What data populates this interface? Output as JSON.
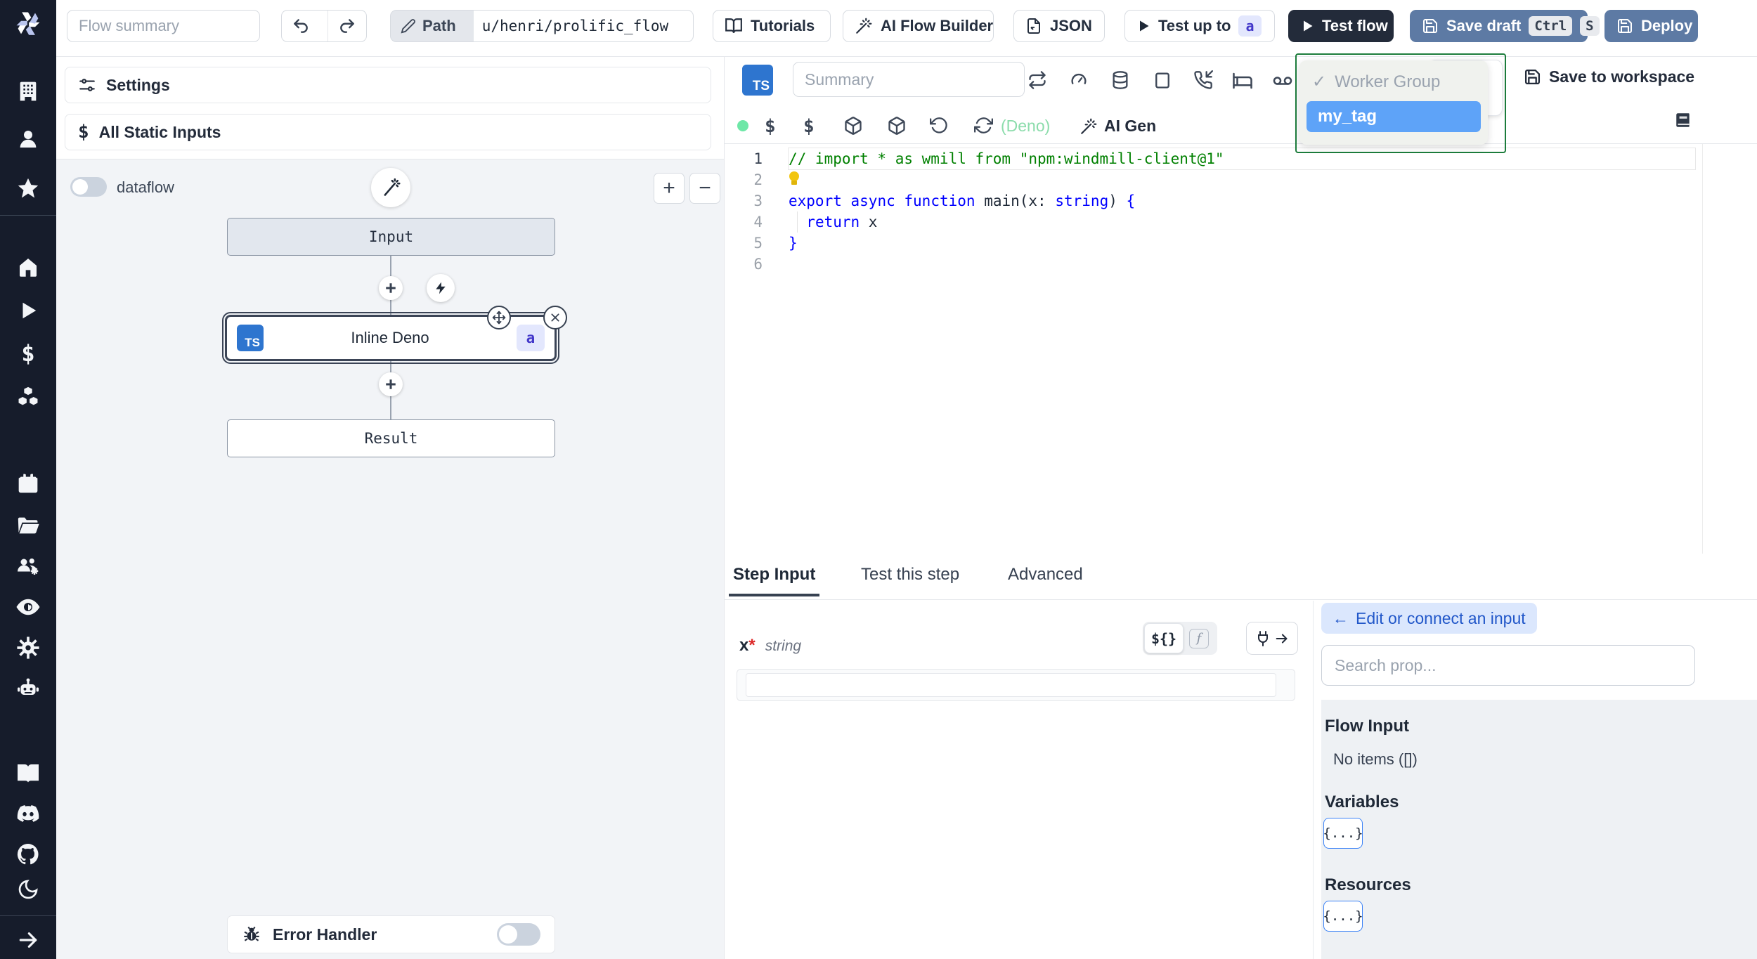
{
  "topbar": {
    "flow_summary_placeholder": "Flow summary",
    "path_label": "Path",
    "path_value": "u/henri/prolific_flow",
    "tutorials_label": "Tutorials",
    "ai_flow_builder_label": "AI Flow Builder",
    "json_label": "JSON",
    "test_up_to_label": "Test up to",
    "test_up_to_badge": "a",
    "test_flow_label": "Test flow",
    "save_draft_label": "Save draft",
    "kbd_ctrl": "Ctrl",
    "kbd_s": "S",
    "deploy_label": "Deploy"
  },
  "left_panel": {
    "settings_label": "Settings",
    "all_static_inputs_label": "All Static Inputs",
    "dollar_glyph": "$",
    "dataflow_label": "dataflow",
    "zoom_in_glyph": "+",
    "zoom_out_glyph": "−",
    "graph": {
      "input_node": "Input",
      "step_lang_badge": "TS",
      "step_node": "Inline Deno",
      "step_id_badge": "a",
      "result_node": "Result"
    },
    "error_handler_label": "Error Handler"
  },
  "editor": {
    "lang_badge": "TS",
    "summary_placeholder": "Summary",
    "deno_label": "(Deno)",
    "ai_gen_label": "AI Gen",
    "save_to_workspace_label": "Save to workspace",
    "worker_group_dropdown": {
      "check_glyph": "✓",
      "group_option": "Worker Group",
      "selected_tag": "my_tag"
    },
    "line_numbers": [
      "1",
      "2",
      "3",
      "4",
      "5",
      "6"
    ],
    "code": [
      [
        [
          "// import * as wmill from \"npm:windmill-client@1\"",
          "comment"
        ]
      ],
      [
        [
          "",
          "bulb"
        ]
      ],
      [
        [
          "export",
          "kw"
        ],
        [
          " ",
          "pl"
        ],
        [
          "async",
          "kw"
        ],
        [
          " ",
          "pl"
        ],
        [
          "function",
          "kw"
        ],
        [
          " ",
          "pl"
        ],
        [
          "main(x: ",
          "pl"
        ],
        [
          "string",
          "kw"
        ],
        [
          ") ",
          "pl"
        ],
        [
          "{",
          "kw"
        ]
      ],
      [
        [
          "  ",
          "pl"
        ],
        [
          "return",
          "kw"
        ],
        [
          " x",
          "pl"
        ]
      ],
      [
        [
          "}",
          "kw"
        ]
      ],
      [
        [
          "",
          "pl"
        ]
      ]
    ]
  },
  "bottom": {
    "tabs": {
      "step_input": "Step Input",
      "test_this_step": "Test this step",
      "advanced": "Advanced"
    },
    "step_form": {
      "arg_name": "x",
      "required_glyph": "*",
      "arg_type": "string",
      "template_toggle": "${}",
      "fn_toggle": "f"
    },
    "prop_panel": {
      "back_glyph": "←",
      "edit_connect_label": "Edit or connect an input",
      "search_placeholder": "Search prop...",
      "flow_input_title": "Flow Input",
      "flow_input_empty": "No items ([])",
      "variables_title": "Variables",
      "resources_title": "Resources",
      "object_glyph": "{...}"
    }
  },
  "colors": {
    "rail_bg": "#161c2b",
    "ts_badge_blue": "#2e75cf",
    "steel_blue_button": "#5d7aa4",
    "dark_button": "#232b3a",
    "dropdown_green_border": "#1c7c3c",
    "selected_tag_blue": "#5ea3f8",
    "badge_indigo_bg": "#e3e7fd",
    "badge_indigo_text": "#4338ca",
    "green_status_dot": "#6ee7a7",
    "deno_green": "#8bdcab",
    "edit_connect_bg": "#dbe7fd"
  }
}
